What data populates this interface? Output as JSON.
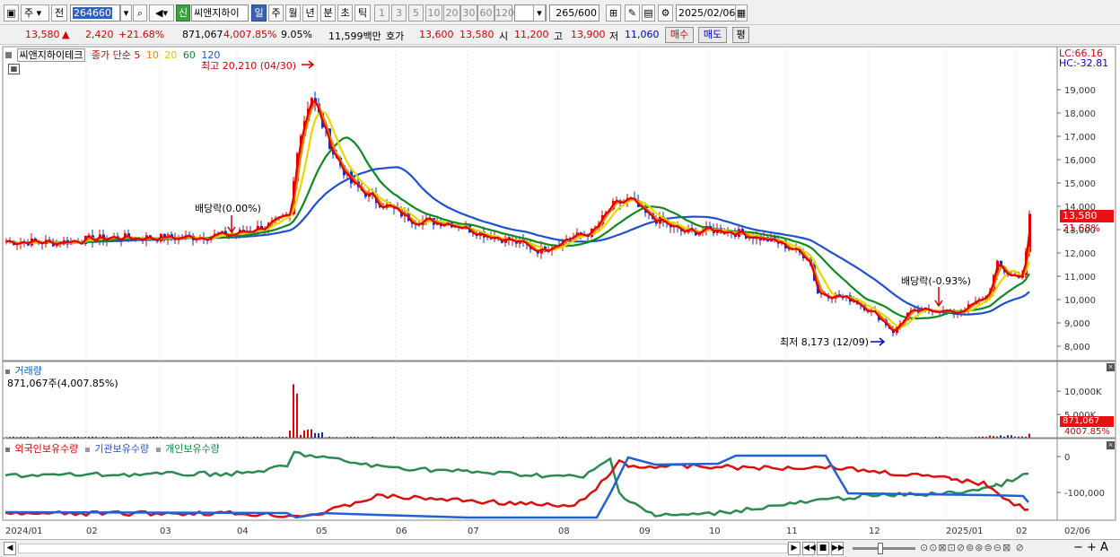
{
  "toolbar": {
    "market": "주",
    "prev": "전",
    "code": "264660",
    "name_badge": "신",
    "name": "씨앤지하이",
    "periods": [
      "일",
      "주",
      "월",
      "년",
      "분",
      "초",
      "틱"
    ],
    "intervals": [
      "1",
      "3",
      "5",
      "10",
      "20",
      "30",
      "60",
      "120"
    ],
    "count": "265",
    "count_total": "/600",
    "date": "2025/02/06"
  },
  "quote": {
    "price": "13,580",
    "arrow": "▲",
    "change": "2,420",
    "change_pct": "+21.68%",
    "volume": "871,067",
    "volume_pct": "4,007.85%",
    "turnover_pct": "9.05%",
    "amount": "11,599백만",
    "ask_label": "호가",
    "ask": "13,600",
    "bid": "13,580",
    "open_label": "시",
    "open": "11,200",
    "high_label": "고",
    "high": "13,900",
    "low_label": "저",
    "low": "11,060",
    "buy_label": "매수",
    "sell_label": "매도",
    "eval_label": "평"
  },
  "price_panel": {
    "title": "씨앤지하이테크",
    "legend_prefix": "종가 단순",
    "ma_labels": [
      "5",
      "10",
      "20",
      "60",
      "120"
    ],
    "ma_colors": [
      "#e00000",
      "#f08000",
      "#e8d800",
      "#108a20",
      "#2050d0"
    ],
    "lc": "LC:66.16",
    "hc": "HC:-32.81",
    "last_price": "13,580",
    "last_pct": "21.68%",
    "high_note": "최고 20,210 (04/30)",
    "low_note": "최저 8,173 (12/09)",
    "div1": "배당락(0.00%)",
    "div2": "배당락(-0.93%)",
    "y_ticks": [
      "19,000",
      "18,000",
      "17,000",
      "16,000",
      "15,000",
      "14,000",
      "13,000",
      "12,000",
      "11,000",
      "10,000",
      "9,000",
      "8,000"
    ]
  },
  "volume_panel": {
    "title": "거래량",
    "sub": "871,067주(4,007.85%)",
    "y_ticks": [
      "10,000K",
      "5,000K"
    ],
    "last_vol": "871,067",
    "last_pct": "4007.85%"
  },
  "holder_panel": {
    "foreign": "외국인보유수량",
    "inst": "기관보유수량",
    "indiv": "개인보유수량",
    "y_ticks": [
      "0",
      "-100,000"
    ]
  },
  "x_axis": [
    "2024/01",
    "02",
    "03",
    "04",
    "05",
    "06",
    "07",
    "08",
    "09",
    "10",
    "11",
    "12",
    "2025/01",
    "02",
    "02/06"
  ]
}
